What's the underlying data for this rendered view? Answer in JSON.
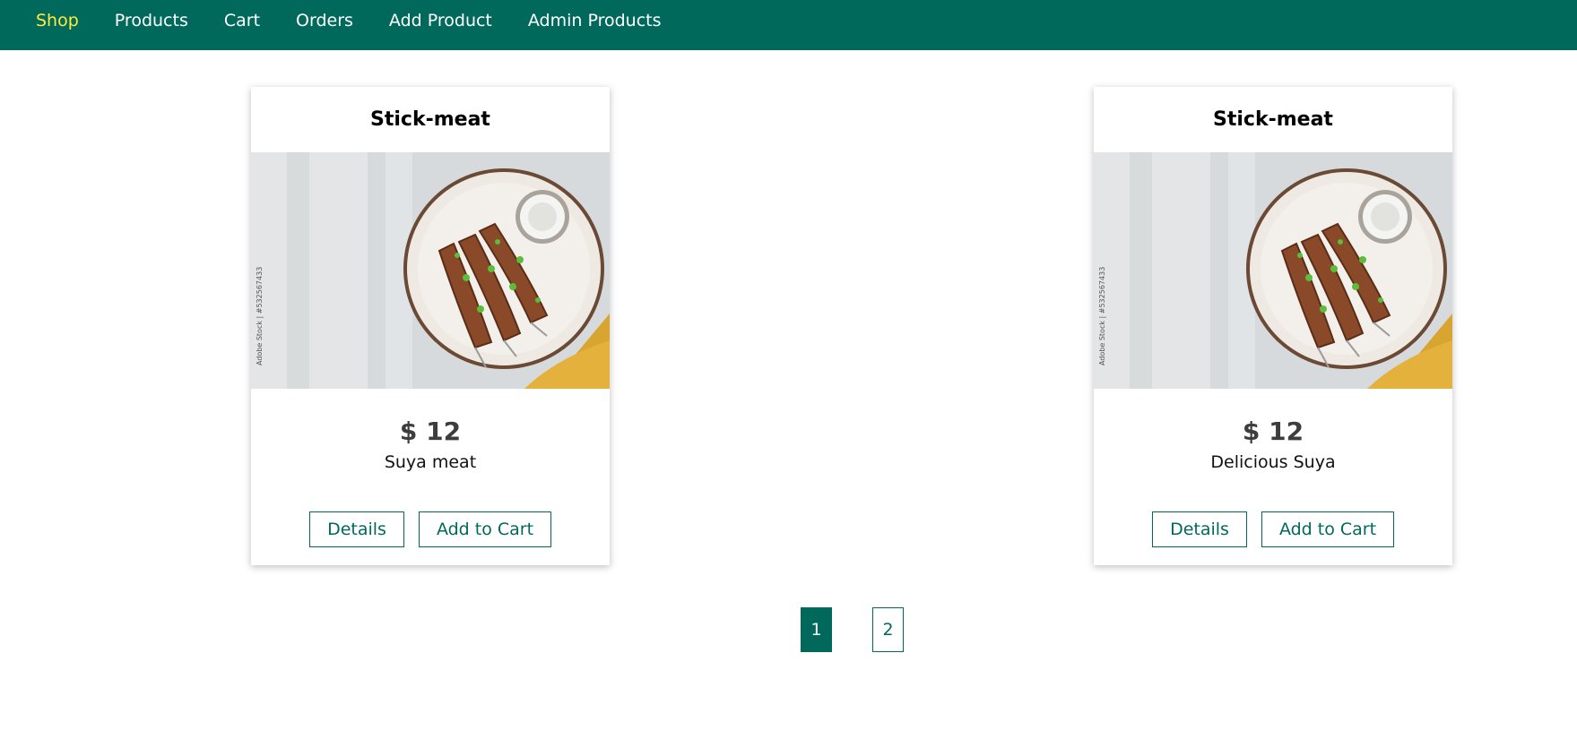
{
  "nav": {
    "items": [
      {
        "label": "Shop",
        "active": true
      },
      {
        "label": "Products"
      },
      {
        "label": "Cart"
      },
      {
        "label": "Orders"
      },
      {
        "label": "Add Product"
      },
      {
        "label": "Admin Products"
      }
    ]
  },
  "products": [
    {
      "title": "Stick-meat",
      "price": "$ 12",
      "description": "Suya meat",
      "details_label": "Details",
      "add_to_cart_label": "Add to Cart"
    },
    {
      "title": "Stick-meat",
      "price": "$ 12",
      "description": "Delicious Suya",
      "details_label": "Details",
      "add_to_cart_label": "Add to Cart"
    }
  ],
  "pagination": {
    "pages": [
      "1",
      "2"
    ],
    "current": "1"
  },
  "colors": {
    "header_bg": "#00695c",
    "active_nav": "#ffeb3b",
    "accent": "#00695c"
  },
  "image_watermark": "Adobe Stock | #532567433"
}
